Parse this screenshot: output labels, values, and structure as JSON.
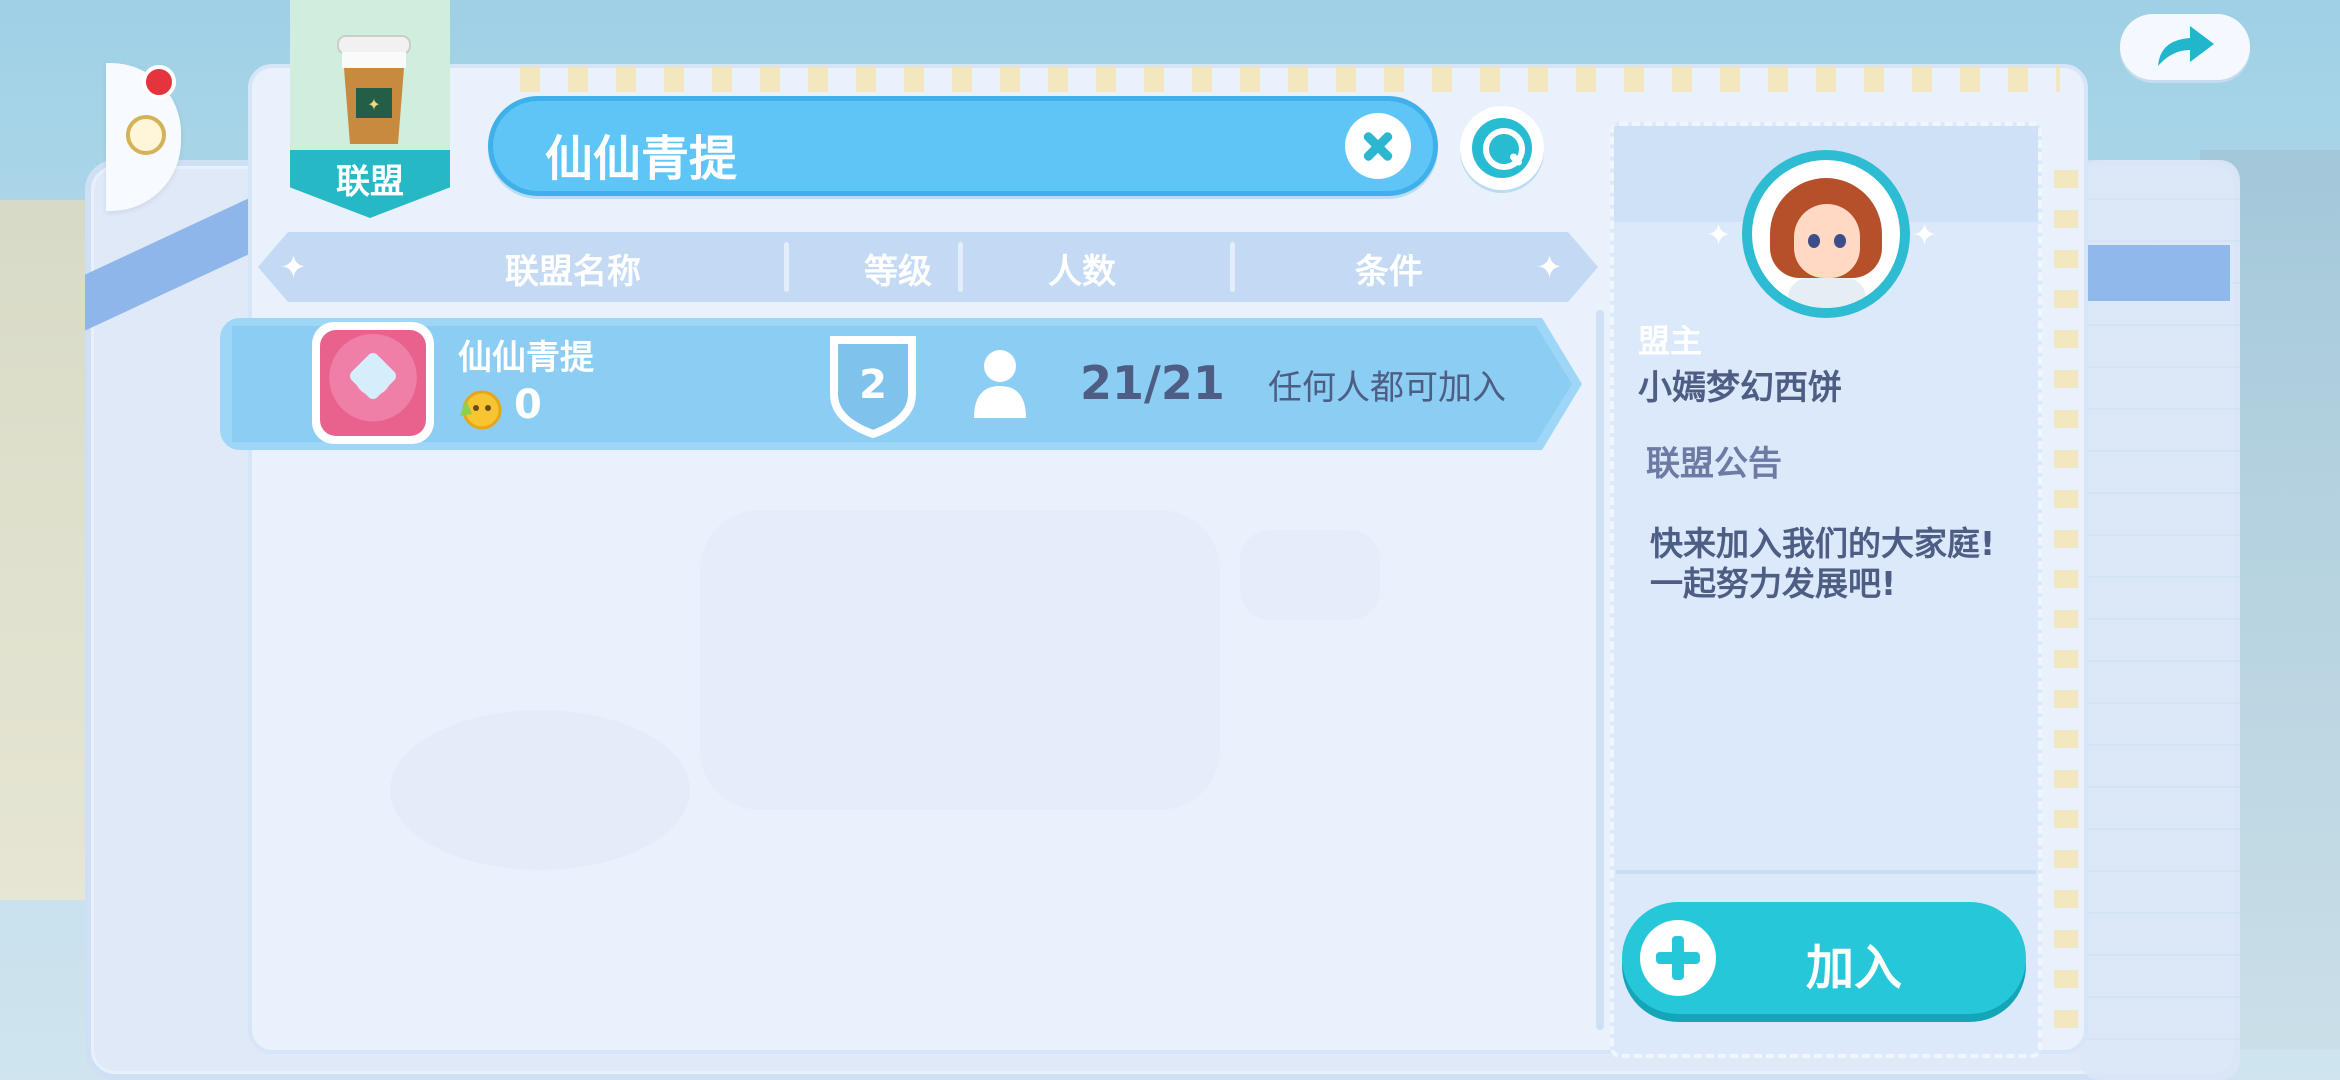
{
  "league_tab": {
    "label": "联盟"
  },
  "search": {
    "value": "仙仙青提"
  },
  "table": {
    "headers": [
      "联盟名称",
      "等级",
      "人数",
      "条件"
    ],
    "rows": [
      {
        "name": "仙仙青提",
        "activity_points": "0",
        "level": "2",
        "members": "21/21",
        "condition": "任何人都可加入"
      }
    ]
  },
  "details": {
    "leader_label": "盟主",
    "leader_name": "小嫣梦幻西饼",
    "notice_title": "联盟公告",
    "notice_text_line1": "快来加入我们的大家庭!",
    "notice_text_line2": "一起努力发展吧!",
    "join_label": "加入"
  },
  "colors": {
    "accent": "#25c7d8",
    "search_bg": "#5ec5f6",
    "row_bg": "#8ccdf3",
    "text_dark": "#4e5d84",
    "notification_dot": "#e5343e"
  },
  "icons": {
    "exit_tab": "gear-icon",
    "league_badge": "coffee-cup-icon",
    "clear": "close-icon",
    "search": "search-icon",
    "emblem": "league-emblem-icon",
    "activity": "activity-coin-icon",
    "level": "shield-level-icon",
    "members": "person-icon",
    "join": "plus-icon",
    "share": "share-arrow-icon"
  }
}
